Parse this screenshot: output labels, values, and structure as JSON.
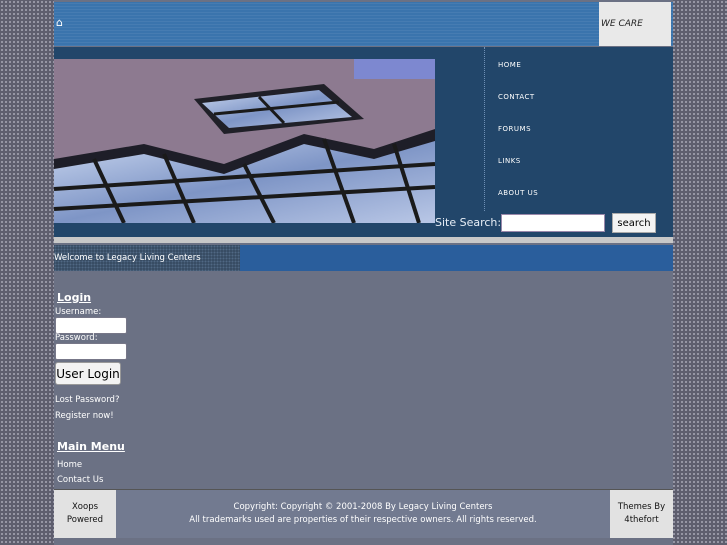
{
  "header": {
    "home_icon": "home-icon",
    "tagline": "WE CARE"
  },
  "nav": {
    "items": [
      "HOME",
      "CONTACT",
      "FORUMS",
      "LINKS",
      "ABOUT US"
    ]
  },
  "search": {
    "label": "Site Search:",
    "button": "search",
    "value": ""
  },
  "welcome": {
    "text": "Welcome to Legacy Living Centers"
  },
  "login": {
    "title": "Login",
    "username_label": "Username:",
    "password_label": "Password:",
    "button": "User Login",
    "lost_password": "Lost Password?",
    "register": "Register now!"
  },
  "main_menu": {
    "title": "Main Menu",
    "items": [
      "Home",
      "Contact Us"
    ]
  },
  "footer": {
    "left_line1": "Xoops",
    "left_line2": "Powered",
    "copyright": "Copyright: Copyright © 2001-2008 By Legacy Living Centers",
    "trademarks": "All trademarks used are properties of their respective owners. All rights reserved.",
    "right_line1": "Themes By",
    "right_line2": "4thefort"
  },
  "colors": {
    "header": "#3a74ad",
    "banner": "#22466a",
    "body": "#6b7184",
    "welcome_bar": "#2a5e9c"
  }
}
